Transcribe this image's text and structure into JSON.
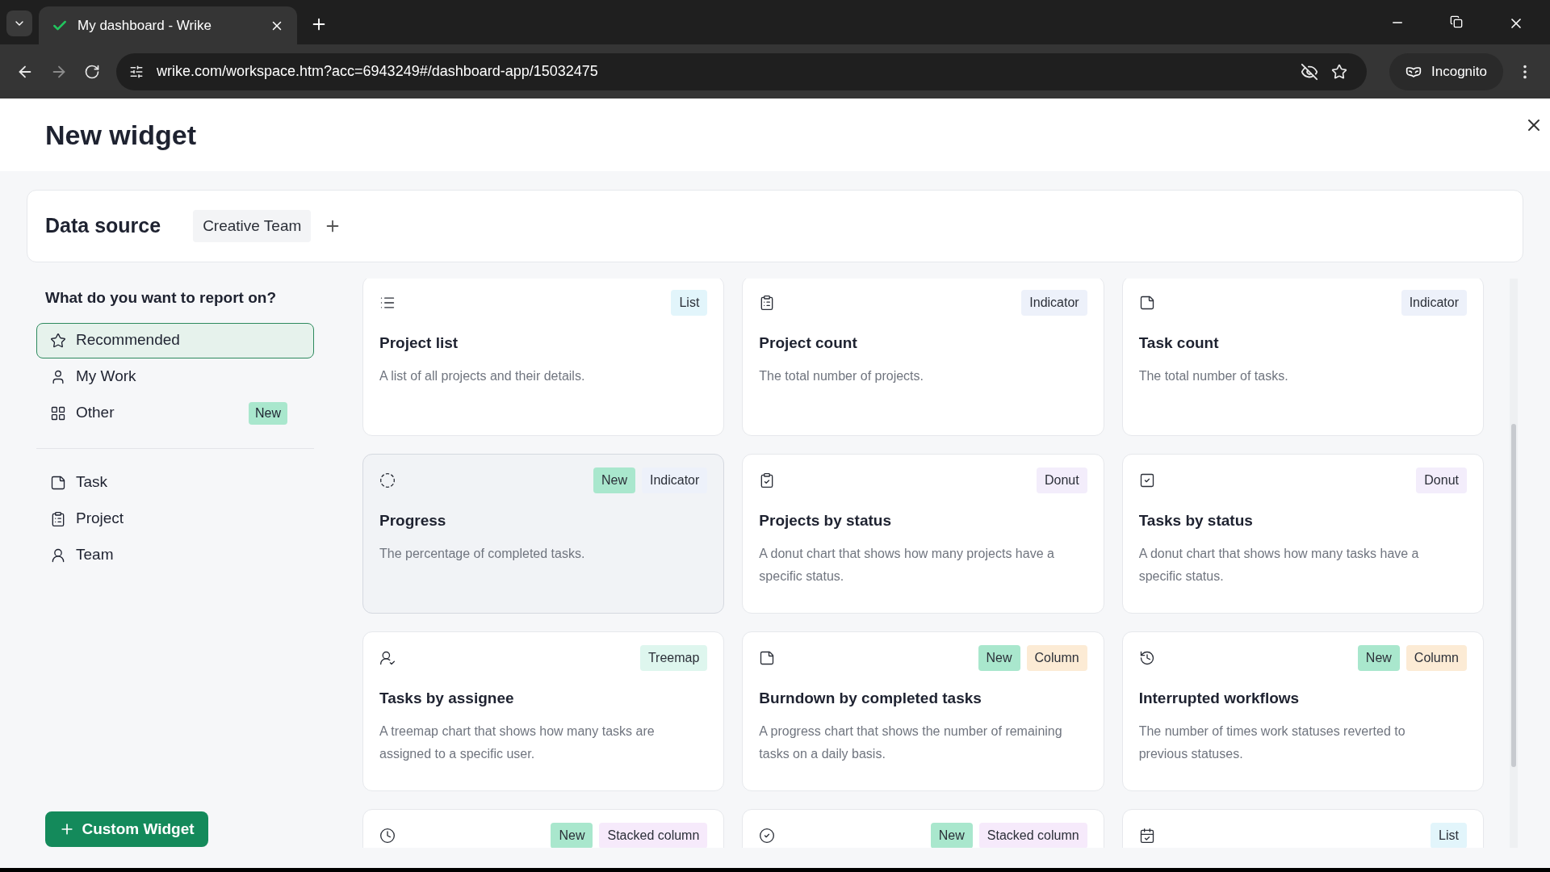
{
  "browser": {
    "tab_title": "My dashboard - Wrike",
    "url": "wrike.com/workspace.htm?acc=6943249#/dashboard-app/15032475",
    "profile": "Incognito"
  },
  "dialog": {
    "title": "New widget"
  },
  "data_source": {
    "label": "Data source",
    "source": "Creative Team"
  },
  "sidebar": {
    "heading": "What do you want to report on?",
    "groups": [
      [
        {
          "label": "Recommended",
          "selected": true
        },
        {
          "label": "My Work",
          "selected": false
        },
        {
          "label": "Other",
          "selected": false,
          "badge": "New"
        }
      ],
      [
        {
          "label": "Task",
          "selected": false
        },
        {
          "label": "Project",
          "selected": false
        },
        {
          "label": "Team",
          "selected": false
        }
      ]
    ],
    "button": "Custom Widget"
  },
  "cards": [
    {
      "title": "Project list",
      "description": "A list of all projects and their details.",
      "selected": false,
      "tags": [
        {
          "kind": "list",
          "label": "List"
        }
      ]
    },
    {
      "title": "Project count",
      "description": "The total number of projects.",
      "selected": false,
      "tags": [
        {
          "kind": "indicator",
          "label": "Indicator"
        }
      ]
    },
    {
      "title": "Task count",
      "description": "The total number of tasks.",
      "selected": false,
      "tags": [
        {
          "kind": "indicator",
          "label": "Indicator"
        }
      ]
    },
    {
      "title": "Progress",
      "description": "The percentage of completed tasks.",
      "selected": true,
      "tags": [
        {
          "kind": "new",
          "label": "New"
        },
        {
          "kind": "indicator",
          "label": "Indicator"
        }
      ]
    },
    {
      "title": "Projects by status",
      "description": "A donut chart that shows how many projects have a specific status.",
      "selected": false,
      "tags": [
        {
          "kind": "donut",
          "label": "Donut"
        }
      ]
    },
    {
      "title": "Tasks by status",
      "description": "A donut chart that shows how many tasks have a specific status.",
      "selected": false,
      "tags": [
        {
          "kind": "donut",
          "label": "Donut"
        }
      ]
    },
    {
      "title": "Tasks by assignee",
      "description": "A treemap chart that shows how many tasks are assigned to a specific user.",
      "selected": false,
      "tags": [
        {
          "kind": "treemap",
          "label": "Treemap"
        }
      ]
    },
    {
      "title": "Burndown by completed tasks",
      "description": "A progress chart that shows the number of remaining tasks on a daily basis.",
      "selected": false,
      "tags": [
        {
          "kind": "new",
          "label": "New"
        },
        {
          "kind": "column",
          "label": "Column"
        }
      ]
    },
    {
      "title": "Interrupted workflows",
      "description": "The number of times work statuses reverted to previous statuses.",
      "selected": false,
      "tags": [
        {
          "kind": "new",
          "label": "New"
        },
        {
          "kind": "column",
          "label": "Column"
        }
      ]
    },
    {
      "selected": false,
      "tags": [
        {
          "kind": "new",
          "label": "New"
        },
        {
          "kind": "stacked",
          "label": "Stacked column"
        }
      ]
    },
    {
      "selected": false,
      "tags": [
        {
          "kind": "new",
          "label": "New"
        },
        {
          "kind": "stacked",
          "label": "Stacked column"
        }
      ]
    },
    {
      "selected": false,
      "tags": [
        {
          "kind": "list",
          "label": "List"
        }
      ]
    }
  ]
}
